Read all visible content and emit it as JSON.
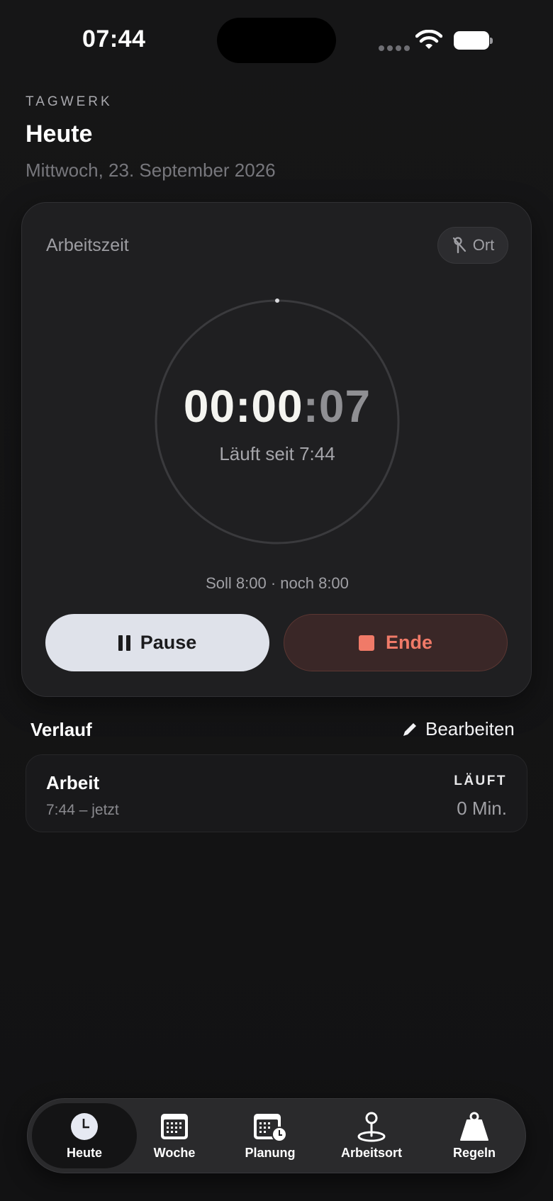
{
  "status_bar": {
    "time": "07:44"
  },
  "header": {
    "app_name": "TAGWERK",
    "title": "Heute",
    "date": "Mittwoch, 23. September 2026"
  },
  "timer_card": {
    "title": "Arbeitszeit",
    "location_button": "Ort",
    "elapsed_hm": "00:00",
    "elapsed_sep": ":",
    "elapsed_sec": "07",
    "running_since": "Läuft seit 7:44",
    "target_info": "Soll 8:00 · noch 8:00",
    "pause_label": "Pause",
    "end_label": "Ende"
  },
  "history": {
    "title": "Verlauf",
    "edit_label": "Bearbeiten",
    "entries": [
      {
        "name": "Arbeit",
        "time_range": "7:44 – jetzt",
        "status": "LÄUFT",
        "duration": "0 Min."
      }
    ]
  },
  "tab_bar": {
    "active": "Heute",
    "tabs": [
      {
        "label": "Heute",
        "icon": "clock-icon"
      },
      {
        "label": "Woche",
        "icon": "calendar-icon"
      },
      {
        "label": "Planung",
        "icon": "calendar-clock-icon"
      },
      {
        "label": "Arbeitsort",
        "icon": "location-pin-icon"
      },
      {
        "label": "Regeln",
        "icon": "weight-icon"
      }
    ]
  },
  "colors": {
    "background": "#141415",
    "card": "#1f1f21",
    "accent_end": "#f07a68",
    "pause_button": "#dfe2ea"
  }
}
